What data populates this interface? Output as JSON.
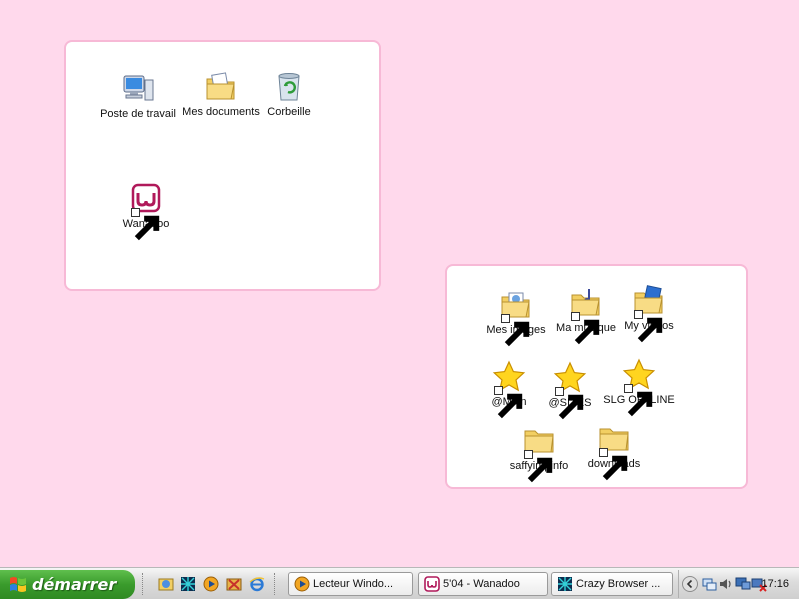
{
  "desktop": {
    "panel_a_icons": [
      {
        "label": "Poste de travail",
        "icon": "computer-icon",
        "shortcut": false
      },
      {
        "label": "Mes documents",
        "icon": "folder-documents-icon",
        "shortcut": false
      },
      {
        "label": "Corbeille",
        "icon": "recycle-bin-icon",
        "shortcut": false
      },
      {
        "label": "Wanadoo",
        "icon": "wanadoo-icon",
        "shortcut": true
      }
    ],
    "panel_b_icons": [
      {
        "label": "Mes images",
        "icon": "folder-pictures-icon",
        "shortcut": true
      },
      {
        "label": "Ma musique",
        "icon": "folder-music-icon",
        "shortcut": true
      },
      {
        "label": "My videos",
        "icon": "folder-videos-icon",
        "shortcut": true
      },
      {
        "label": "@Main",
        "icon": "star-icon",
        "shortcut": true
      },
      {
        "label": "@SITES",
        "icon": "star-icon",
        "shortcut": true
      },
      {
        "label": "SLG OFFLINE",
        "icon": "star-icon",
        "shortcut": true
      },
      {
        "label": "saffyimpinfo",
        "icon": "folder-icon",
        "shortcut": true
      },
      {
        "label": "downloads",
        "icon": "folder-icon",
        "shortcut": true
      }
    ]
  },
  "taskbar": {
    "start_label": "démarrer",
    "quick_launch": [
      "explorer-icon",
      "crazy-browser-icon",
      "media-player-icon",
      "tool-icon",
      "internet-explorer-icon"
    ],
    "tasks": [
      {
        "label": "Lecteur Windo...",
        "icon": "media-player-icon"
      },
      {
        "label": "5'04 - Wanadoo",
        "icon": "wanadoo-icon"
      },
      {
        "label": "Crazy Browser ...",
        "icon": "crazy-browser-icon"
      }
    ],
    "tray_icons": [
      "network-icon",
      "volume-icon",
      "monitor-icon",
      "network-disconnected-icon"
    ],
    "clock": "17:16"
  },
  "colors": {
    "background": "#ffd9ec",
    "panel": "#ffffff",
    "panel_border": "#f7b9d6",
    "start_green": "#3a9b2c"
  }
}
